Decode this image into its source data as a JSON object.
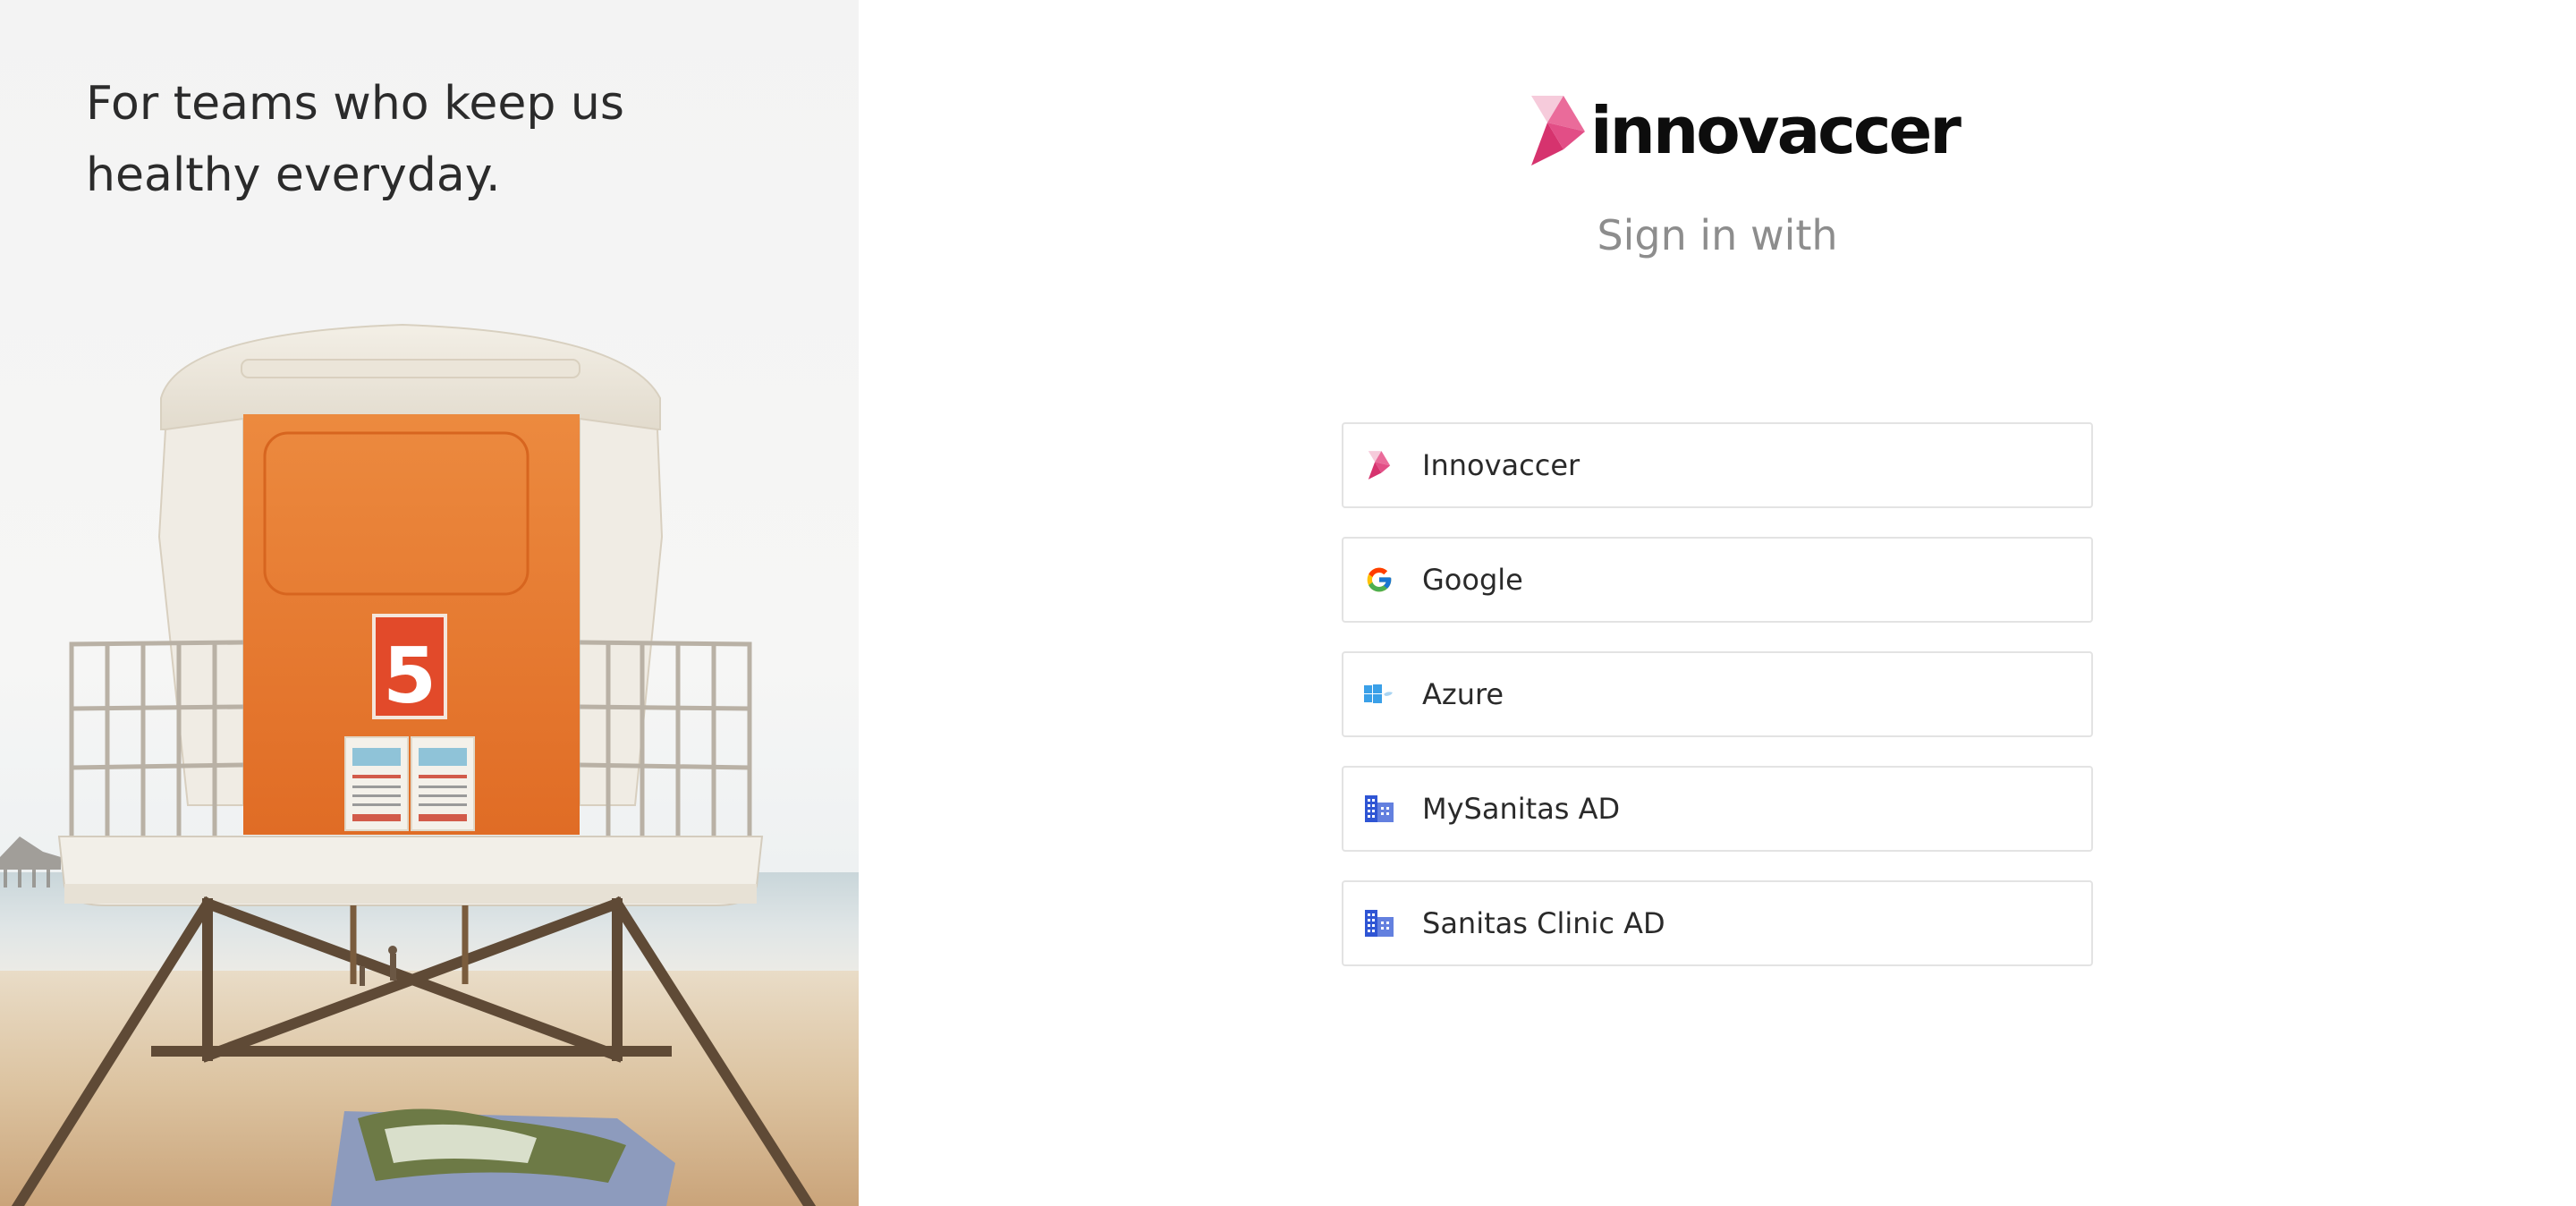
{
  "hero": {
    "tagline_line1": "For teams who keep us",
    "tagline_line2": "healthy everyday.",
    "image_subject": "lifeguard tower on beach",
    "tower_number": "5"
  },
  "brand": {
    "name": "innovaccer",
    "logo_icon": "innovaccer-logo-icon",
    "colors": {
      "pink_light": "#f5c6d6",
      "pink": "#e8508a",
      "pink_dark": "#d6336e"
    }
  },
  "signin": {
    "heading": "Sign in with",
    "providers": [
      {
        "label": "Innovaccer",
        "icon": "innovaccer-logo-icon"
      },
      {
        "label": "Google",
        "icon": "google-icon"
      },
      {
        "label": "Azure",
        "icon": "azure-windows-icon"
      },
      {
        "label": "MySanitas AD",
        "icon": "building-icon"
      },
      {
        "label": "Sanitas Clinic AD",
        "icon": "building-icon"
      }
    ]
  }
}
